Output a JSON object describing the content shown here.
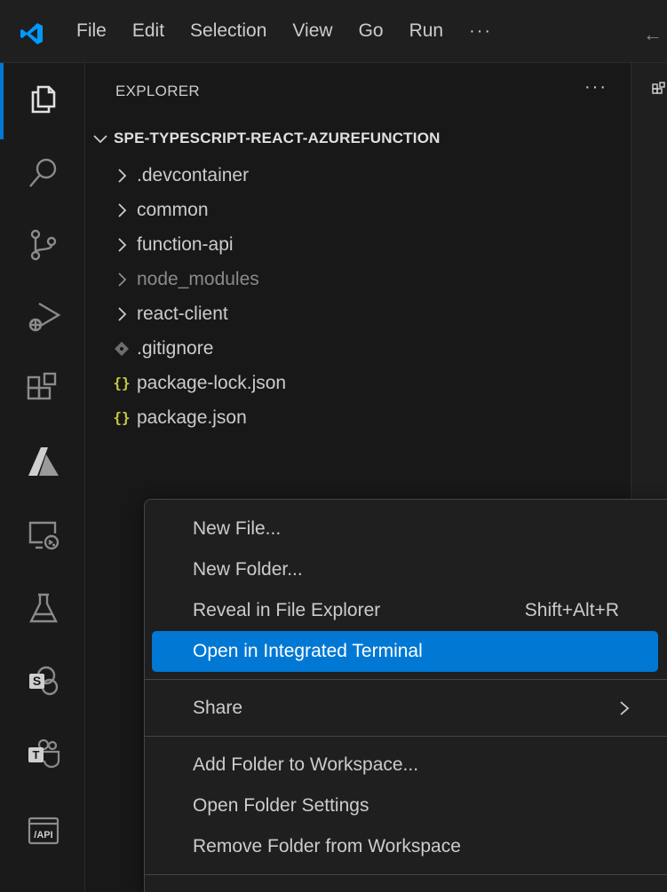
{
  "menubar": {
    "items": [
      "File",
      "Edit",
      "Selection",
      "View",
      "Go",
      "Run"
    ],
    "more": "···"
  },
  "activity_bar": {
    "icons": [
      "explorer-icon",
      "search-icon",
      "source-control-icon",
      "run-debug-icon",
      "extensions-icon",
      "azure-icon",
      "remote-explorer-icon",
      "testing-icon",
      "sharepoint-icon",
      "teams-toolkit-icon",
      "api-icon"
    ]
  },
  "sidebar": {
    "title": "EXPLORER",
    "more": "···",
    "folder_name": "SPE-TYPESCRIPT-REACT-AZUREFUNCTION",
    "items": [
      {
        "label": ".devcontainer",
        "type": "folder"
      },
      {
        "label": "common",
        "type": "folder"
      },
      {
        "label": "function-api",
        "type": "folder"
      },
      {
        "label": "node_modules",
        "type": "folder",
        "dimmed": true
      },
      {
        "label": "react-client",
        "type": "folder"
      },
      {
        "label": ".gitignore",
        "type": "git-file"
      },
      {
        "label": "package-lock.json",
        "type": "json-file"
      },
      {
        "label": "package.json",
        "type": "json-file"
      }
    ],
    "json_glyph": "{}"
  },
  "context_menu": {
    "items": [
      {
        "label": "New File..."
      },
      {
        "label": "New Folder..."
      },
      {
        "label": "Reveal in File Explorer",
        "shortcut": "Shift+Alt+R"
      },
      {
        "label": "Open in Integrated Terminal",
        "highlighted": true
      },
      {
        "label": "Share",
        "submenu": true
      },
      {
        "label": "Add Folder to Workspace..."
      },
      {
        "label": "Open Folder Settings"
      },
      {
        "label": "Remove Folder from Workspace"
      }
    ]
  },
  "colors": {
    "accent": "#0078d4",
    "json_icon": "#cbcb41",
    "background": "#181818"
  }
}
